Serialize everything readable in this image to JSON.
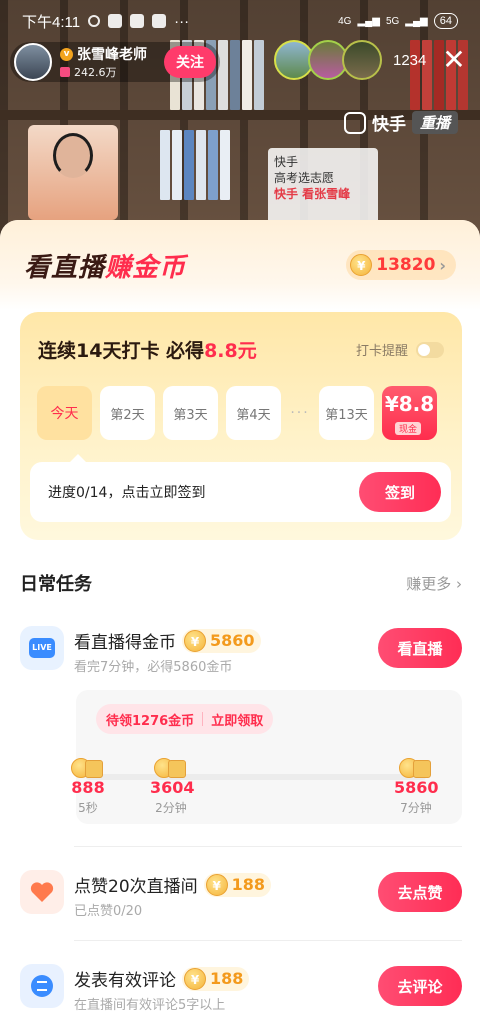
{
  "status_bar": {
    "time": "下午4:11",
    "network_1": "4G",
    "network_2": "5G",
    "battery": "64"
  },
  "streamer": {
    "name": "张雪峰老师",
    "fans": "242.6万",
    "follow_label": "关注",
    "viewer_count": "1234"
  },
  "stream": {
    "brand": "快手",
    "replay_label": "重播",
    "poster_line1": "快手",
    "poster_line2": "高考选志愿",
    "poster_line3": "快手 看张雪峰"
  },
  "sheet": {
    "title_part1": "看直播",
    "title_part2": "赚金币",
    "coin_total": "13820"
  },
  "checkin": {
    "heading": "连续14天打卡 必得",
    "heading_amount": "8.8元",
    "remind_label": "打卡提醒",
    "days": [
      "今天",
      "第2天",
      "第3天",
      "第4天"
    ],
    "dots": "···",
    "day_13": "第13天",
    "final_value": "¥8.8",
    "final_tag": "现金",
    "progress_text": "进度0/14，点击立即签到",
    "signin_label": "签到"
  },
  "tasks": {
    "title": "日常任务",
    "more_label": "赚更多",
    "watch": {
      "icon_label": "LIVE",
      "title": "看直播得金币",
      "reward": "5860",
      "sub": "看完7分钟，必得5860金币",
      "button": "看直播",
      "claim_text": "待领1276金币",
      "claim_action": "立即领取",
      "milestones": [
        {
          "value": "888",
          "time": "5秒"
        },
        {
          "value": "3604",
          "time": "2分钟"
        },
        {
          "value": "5860",
          "time": "7分钟"
        }
      ]
    },
    "like": {
      "title": "点赞20次直播间",
      "reward": "188",
      "sub": "已点赞0/20",
      "button": "去点赞"
    },
    "comment": {
      "title": "发表有效评论",
      "reward": "188",
      "sub": "在直播间有效评论5字以上",
      "button": "去评论"
    }
  }
}
